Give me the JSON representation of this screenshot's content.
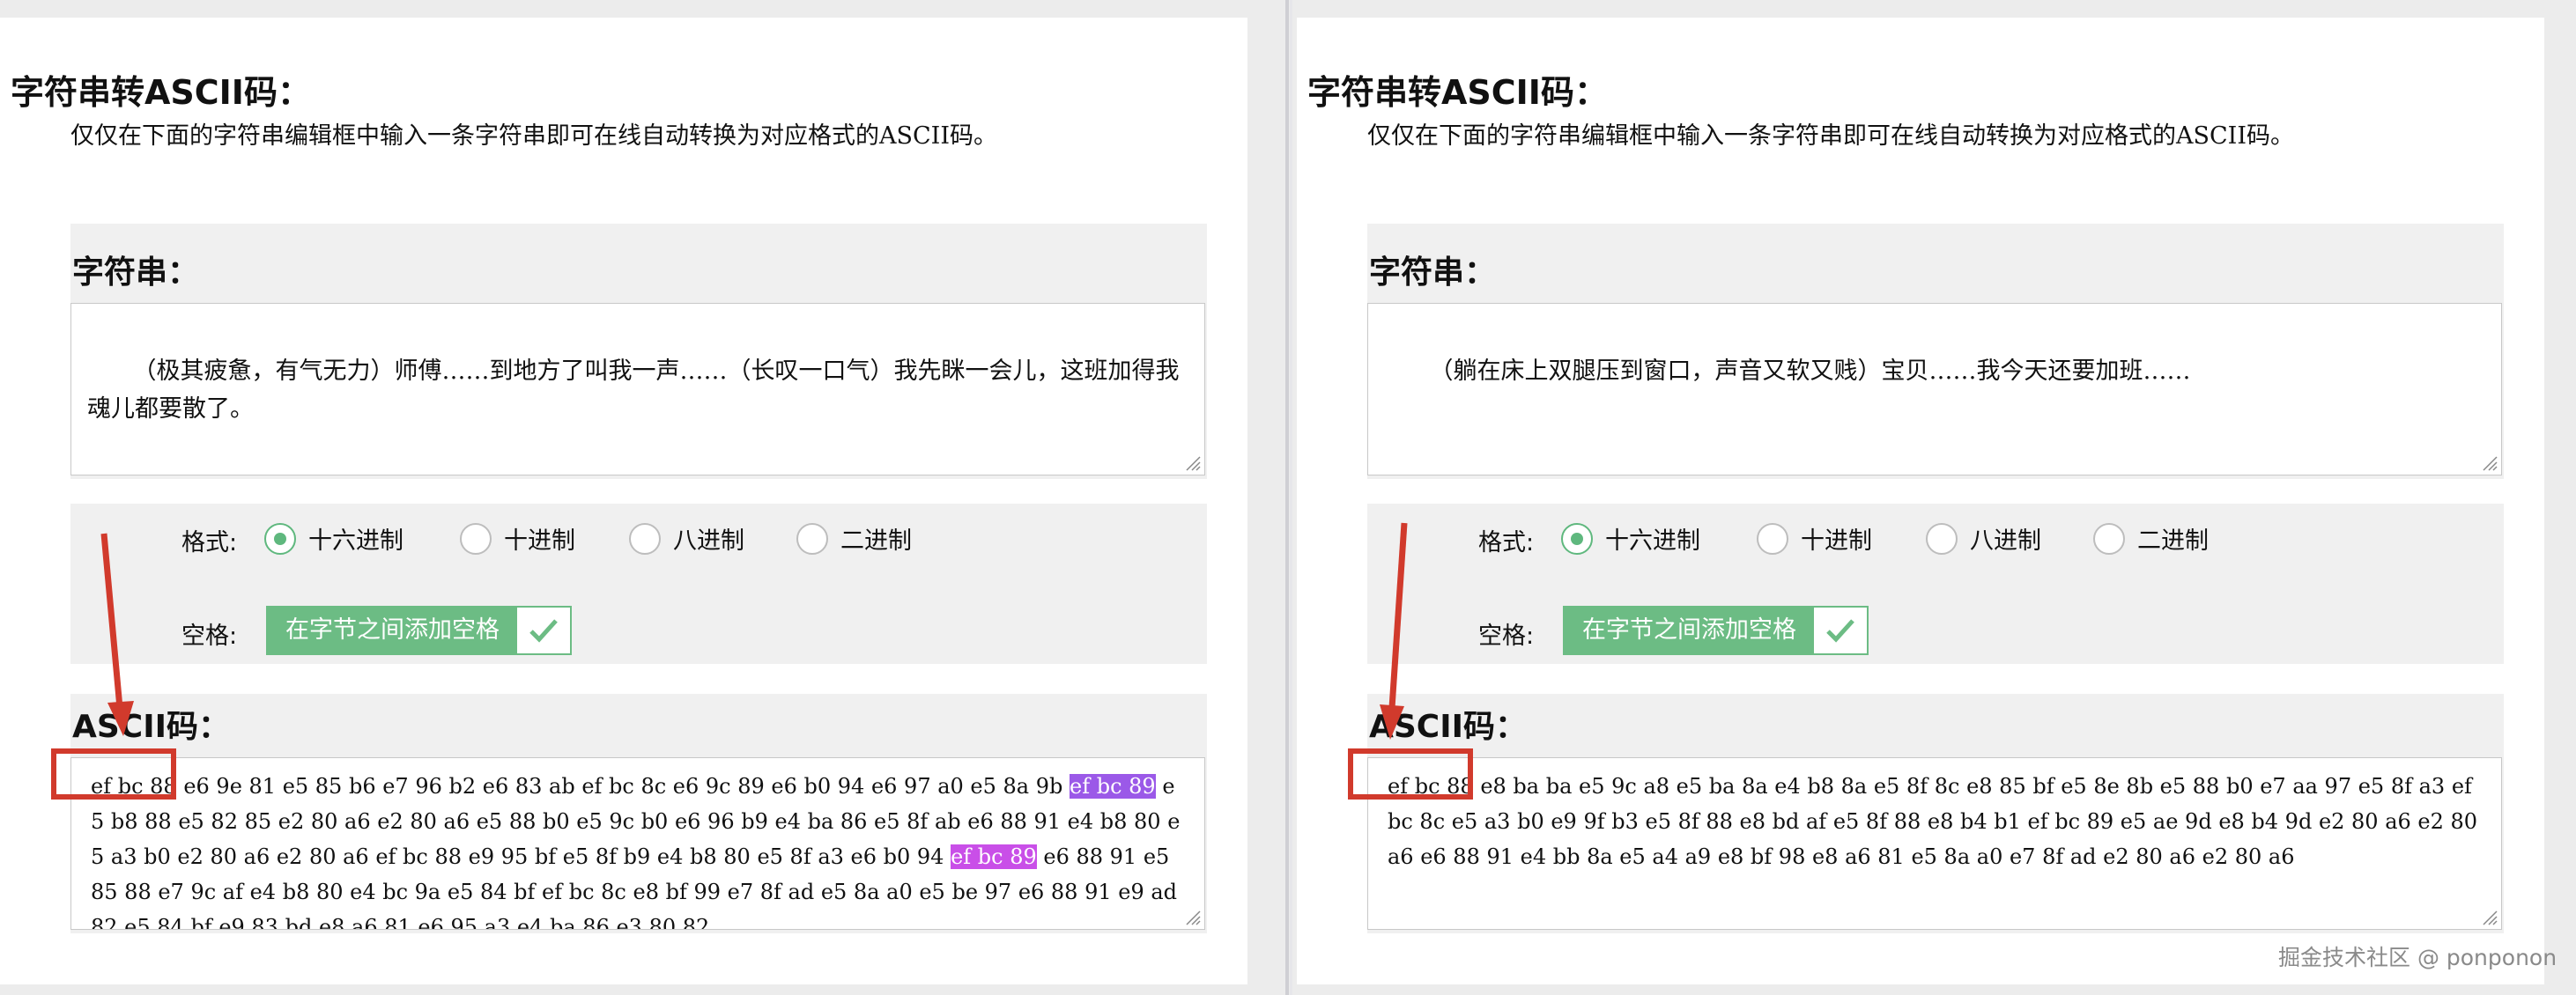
{
  "left": {
    "title": "字符串转ASCII码：",
    "description": "仅仅在下面的字符串编辑框中输入一条字符串即可在线自动转换为对应格式的ASCII码。",
    "string_label": "字符串：",
    "string_value": "（极其疲惫，有气无力）师傅……到地方了叫我一声……（长叹一口气）我先眯一会儿，这班加得我魂儿都要散了。",
    "format_label": "格式:",
    "formats": [
      "十六进制",
      "十进制",
      "八进制",
      "二进制"
    ],
    "selected_format": "十六进制",
    "space_label": "空格:",
    "space_toggle": "在字节之间添加空格",
    "ascii_label": "ASCII码：",
    "ascii_parts": [
      {
        "text": "ef bc 88",
        "hl": ""
      },
      {
        "text": " e6 9e 81 e5 85 b6 e7 96 b2 e6 83 ab ef bc 8c e6 9c 89 e6 b0 94 e6 97 a0 e5 8a 9b ",
        "hl": ""
      },
      {
        "text": "ef bc 89",
        "hl": "purple"
      },
      {
        "text": " e5 b8 88 e5 82 85 e2 80 a6 e2 80 a6 e5 88 b0 e5 9c b0 e6 96 b9 e4 ba 86 e5 8f ab e6 88 91 e4 b8 80 e5 a3 b0 e2 80 a6 e2 80 a6 ef bc 88 e9 95 bf e5 8f b9 e4 b8 80 e5 8f a3 e6 b0 94 ",
        "hl": ""
      },
      {
        "text": "ef bc 89",
        "hl": "magenta"
      },
      {
        "text": " e6 88 91 e5 85 88 e7 9c af e4 b8 80 e4 bc 9a e5 84 bf ef bc 8c e8 bf 99 e7 8f ad e5 8a a0 e5 be 97 e6 88 91 e9 ad 82 e5 84 bf e9 83 bd e8 a6 81 e6 95 a3 e4 ba 86 e3 80 82",
        "hl": ""
      }
    ]
  },
  "right": {
    "title": "字符串转ASCII码：",
    "description": "仅仅在下面的字符串编辑框中输入一条字符串即可在线自动转换为对应格式的ASCII码。",
    "string_label": "字符串：",
    "string_value": "（躺在床上双腿压到窗口，声音又软又贱）宝贝……我今天还要加班……",
    "format_label": "格式:",
    "formats": [
      "十六进制",
      "十进制",
      "八进制",
      "二进制"
    ],
    "selected_format": "十六进制",
    "space_label": "空格:",
    "space_toggle": "在字节之间添加空格",
    "ascii_label": "ASCII码：",
    "ascii_parts": [
      {
        "text": "ef bc 88",
        "hl": ""
      },
      {
        "text": " e8 ba ba e5 9c a8 e5 ba 8a e4 b8 8a e5 8f 8c e8 85 bf e5 8e 8b e5 88 b0 e7 aa 97 e5 8f a3 ef bc 8c e5 a3 b0 e9 9f b3 e5 8f 88 e8 bd af e5 8f 88 e8 b4 b1 ef bc 89 e5 ae 9d e8 b4 9d e2 80 a6 e2 80 a6 e6 88 91 e4 bb 8a e5 a4 a9 e8 bf 98 e8 a6 81 e5 8a a0 e7 8f ad e2 80 a6 e2 80 a6",
        "hl": ""
      }
    ]
  },
  "watermark": "掘金技术社区 @ ponponon",
  "colors": {
    "accent_green": "#6cbc84",
    "annotation_red": "#d13a2c",
    "highlight_purple": "#9b59e8",
    "highlight_magenta": "#c94fe8"
  },
  "icons": {
    "toggle_check": "checkmark-icon",
    "resize": "resize-grip-icon",
    "annotation": "red-arrow"
  }
}
